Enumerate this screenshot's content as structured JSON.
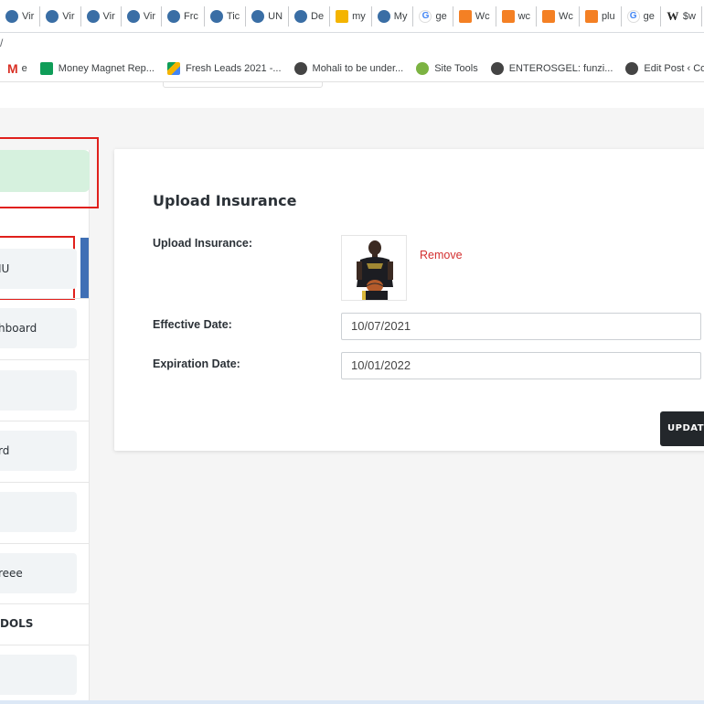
{
  "browser": {
    "tabs": [
      {
        "label": "Vir",
        "icon": "globe-icon"
      },
      {
        "label": "Vir",
        "icon": "globe-icon"
      },
      {
        "label": "Vir",
        "icon": "globe-icon"
      },
      {
        "label": "Vir",
        "icon": "globe-icon"
      },
      {
        "label": "Frc",
        "icon": "globe-icon"
      },
      {
        "label": "Tic",
        "icon": "globe-icon"
      },
      {
        "label": "UN",
        "icon": "globe-icon"
      },
      {
        "label": "De",
        "icon": "globe-icon"
      },
      {
        "label": "my",
        "icon": "drive-icon"
      },
      {
        "label": "My",
        "icon": "globe-icon"
      },
      {
        "label": "ge",
        "icon": "google-icon"
      },
      {
        "label": "Wc",
        "icon": "stackoverflow-icon"
      },
      {
        "label": "wc",
        "icon": "stackoverflow-icon"
      },
      {
        "label": "Wc",
        "icon": "stackoverflow-icon"
      },
      {
        "label": "plu",
        "icon": "stackoverflow-icon"
      },
      {
        "label": "ge",
        "icon": "google-icon"
      },
      {
        "label": "$w",
        "icon": "wikipedia-icon"
      }
    ],
    "url_fragment": "/",
    "bookmarks": [
      {
        "label": "e",
        "icon": "gmail-icon"
      },
      {
        "label": "Money Magnet Rep...",
        "icon": "plus-square-icon"
      },
      {
        "label": "Fresh Leads 2021 -...",
        "icon": "drive-icon"
      },
      {
        "label": "Mohali to be under...",
        "icon": "globe-icon"
      },
      {
        "label": "Site Tools",
        "icon": "site-icon"
      },
      {
        "label": "ENTEROSGEL: funzi...",
        "icon": "globe-icon"
      },
      {
        "label": "Edit Post ‹ Colon I",
        "icon": "globe-icon"
      }
    ]
  },
  "sidebar": {
    "items": [
      {
        "label": "IU"
      },
      {
        "label": "hboard"
      },
      {
        "label": ""
      },
      {
        "label": "rd"
      },
      {
        "label": ""
      },
      {
        "label": "reee"
      },
      {
        "label": ""
      }
    ],
    "section_heading": "DOLS"
  },
  "form": {
    "title": "Upload Insurance",
    "upload_label": "Upload Insurance:",
    "remove_label": "Remove",
    "effective_label": "Effective Date:",
    "effective_value": "10/07/2021",
    "expiration_label": "Expiration Date:",
    "expiration_value": "10/01/2022",
    "update_label": "UPDATE"
  },
  "colors": {
    "accent_blue": "#3f6fb5",
    "highlight_red": "#e0201c",
    "remove_red": "#d32f2f",
    "button_dark": "#23272b",
    "green_tint": "#d6f1de"
  }
}
